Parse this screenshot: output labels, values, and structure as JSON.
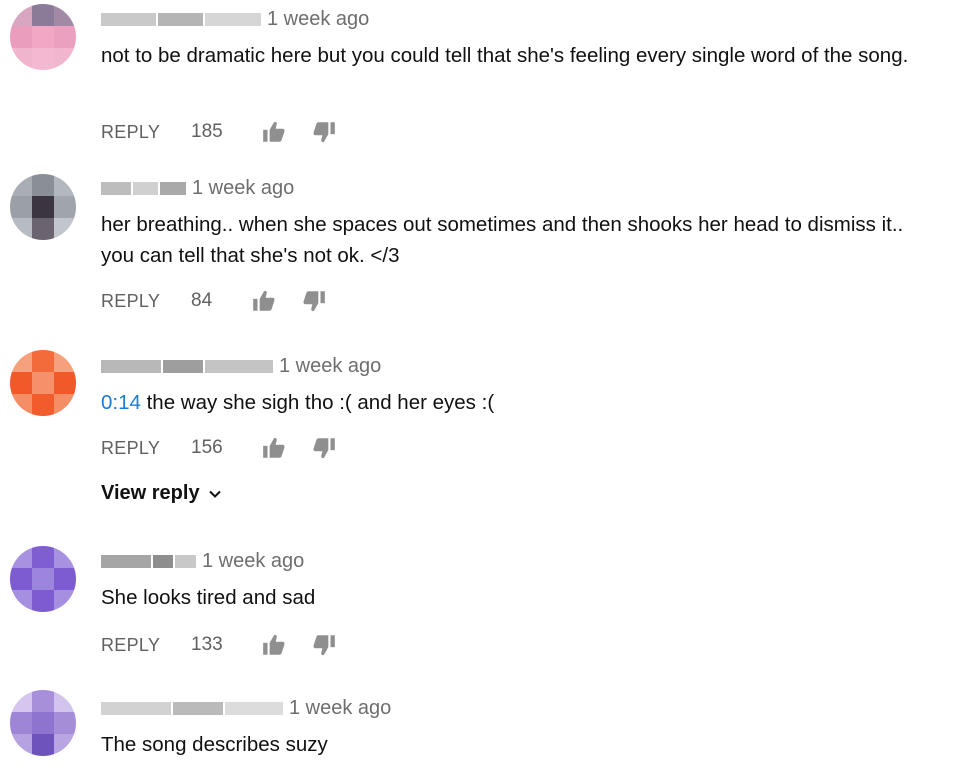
{
  "comments": [
    {
      "time": "1 week ago",
      "text": "not to be dramatic here but you could tell that she's feeling every single word of the song.",
      "reply_label": "REPLY",
      "likes": "185",
      "avatar_color": "#e78fb0"
    },
    {
      "time": "1 week ago",
      "text": "her breathing.. when she spaces out sometimes and then shooks her head to dismiss it.. you can tell that she's not ok. </3",
      "reply_label": "REPLY",
      "likes": "84",
      "avatar_color": "#8c9099"
    },
    {
      "time": "1 week ago",
      "timestamp": "0:14",
      "text": " the way she sigh tho :( and her eyes :(",
      "reply_label": "REPLY",
      "likes": "156",
      "avatar_color": "#f35526",
      "view_reply_label": "View reply"
    },
    {
      "time": "1 week ago",
      "text": "She looks tired and sad",
      "reply_label": "REPLY",
      "likes": "133",
      "avatar_color": "#7e5bd0"
    },
    {
      "time": "1 week ago",
      "text": "The song describes suzy",
      "avatar_color": "#9b7fd6"
    }
  ],
  "colors": {
    "link_blue": "#1a7dd6",
    "muted_gray": "#606060",
    "text": "#111111"
  },
  "icons": {
    "like": "thumbs-up-icon",
    "dislike": "thumbs-down-icon",
    "expand": "chevron-down-icon"
  }
}
